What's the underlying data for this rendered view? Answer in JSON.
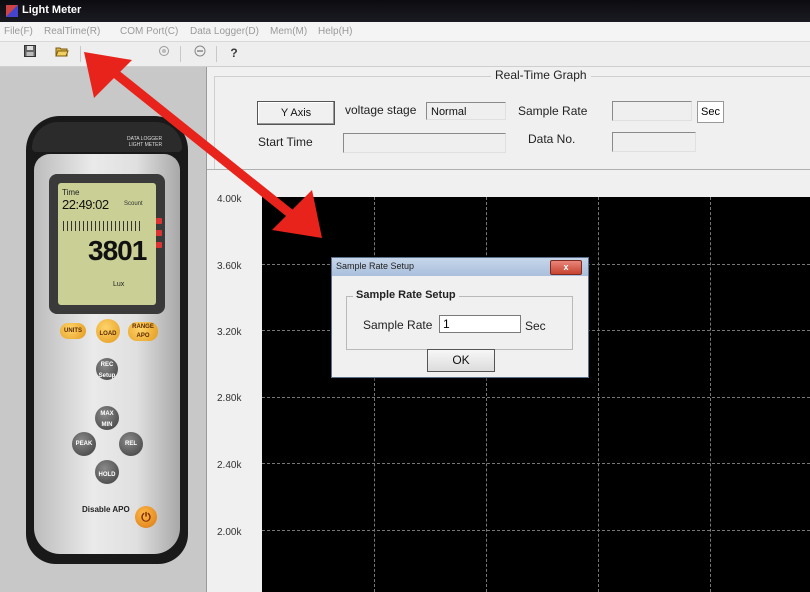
{
  "window": {
    "title": "Light Meter"
  },
  "menu": [
    "File(F)",
    "RealTime(R)",
    "COM Port(C)",
    "Data Logger(D)",
    "Mem(M)",
    "Help(H)"
  ],
  "toolbar": {
    "icons": [
      "save-icon",
      "open-folder-icon",
      "record-icon",
      "stop-icon",
      "help-icon"
    ]
  },
  "graph": {
    "title": "Real-Time  Graph",
    "y_axis_button": "Y Axis",
    "voltage_stage_label": "voltage stage",
    "voltage_stage_value": "Normal",
    "sample_rate_label": "Sample Rate",
    "sample_rate_value": "",
    "sample_rate_unit": "Sec",
    "start_time_label": "Start Time",
    "start_time_value": "",
    "data_no_label": "Data No.",
    "data_no_value": "",
    "y_ticks": [
      "4.00k",
      "3.60k",
      "3.20k",
      "2.80k",
      "2.40k",
      "2.00k"
    ],
    "plot_background": "#000000"
  },
  "dialog": {
    "title": "Sample Rate Setup",
    "close_label": "x",
    "group_title": "Sample Rate Setup",
    "sample_rate_label": "Sample Rate",
    "sample_rate_value": "1",
    "unit": "Sec",
    "ok_label": "OK"
  },
  "device": {
    "brand_line1": "DATA LOGGER",
    "brand_line2": "LIGHT METER",
    "lcd_time_label": "Time",
    "lcd_time": "22:49:02",
    "lcd_secount": "Scount",
    "lcd_reading": "3801",
    "lcd_unit": "Lux",
    "keys": {
      "units": "UNITS",
      "load": "LOAD",
      "range": "RANGE APO",
      "rec": "REC Setup",
      "max": "MAX MIN",
      "peak": "PEAK",
      "rel": "REL",
      "hold": "HOLD"
    },
    "apo_label": "Disable APO"
  },
  "annotation": {
    "arrow_color": "#e8231c"
  }
}
